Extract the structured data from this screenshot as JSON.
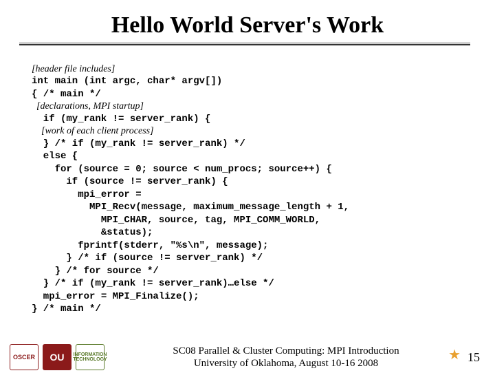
{
  "title": "Hello World Server's Work",
  "code": {
    "l1": "[header file includes]",
    "l2": "int main (int argc, char* argv[])",
    "l3": "{ /* main */",
    "l4": "  [declarations, MPI startup]",
    "l5": "  if (my_rank != server_rank) {",
    "l6": "    [work of each client process]",
    "l7": "  } /* if (my_rank != server_rank) */",
    "l8": "  else {",
    "l9": "    for (source = 0; source < num_procs; source++) {",
    "l10": "      if (source != server_rank) {",
    "l11": "        mpi_error =",
    "l12": "          MPI_Recv(message, maximum_message_length + 1,",
    "l13": "            MPI_CHAR, source, tag, MPI_COMM_WORLD,",
    "l14": "            &status);",
    "l15": "        fprintf(stderr, \"%s\\n\", message);",
    "l16": "      } /* if (source != server_rank) */",
    "l17": "    } /* for source */",
    "l18": "  } /* if (my_rank != server_rank)…else */",
    "l19": "  mpi_error = MPI_Finalize();",
    "l20": "} /* main */"
  },
  "footer": {
    "line1": "SC08 Parallel & Cluster Computing: MPI Introduction",
    "line2": "University of Oklahoma, August 10-16 2008"
  },
  "logos": {
    "oscer": "OSCER",
    "ou": "OU",
    "it": "INFORMATION TECHNOLOGY"
  },
  "page": "15"
}
